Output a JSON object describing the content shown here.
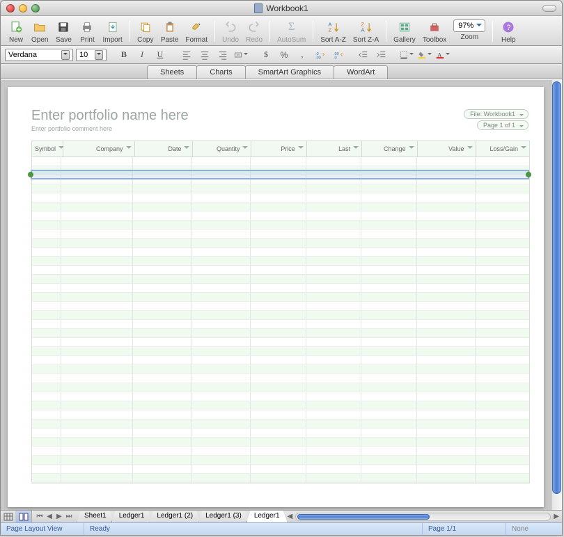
{
  "window": {
    "title": "Workbook1"
  },
  "toolbar": {
    "new": "New",
    "open": "Open",
    "save": "Save",
    "print": "Print",
    "import": "Import",
    "copy": "Copy",
    "paste": "Paste",
    "format": "Format",
    "undo": "Undo",
    "redo": "Redo",
    "autosum": "AutoSum",
    "sortaz": "Sort A-Z",
    "sortza": "Sort Z-A",
    "gallery": "Gallery",
    "toolbox": "Toolbox",
    "zoom": "Zoom",
    "zoom_value": "97%",
    "help": "Help"
  },
  "format_bar": {
    "font": "Verdana",
    "size": "10"
  },
  "tabs": {
    "sheets": "Sheets",
    "charts": "Charts",
    "smartart": "SmartArt Graphics",
    "wordart": "WordArt"
  },
  "portfolio": {
    "title": "Enter portfolio name here",
    "subtitle": "Enter portfolio comment here",
    "file_info": "File: Workbook1",
    "page_info": "Page 1 of 1",
    "columns": [
      "Symbol",
      "Company",
      "Date",
      "Quantity",
      "Price",
      "Last",
      "Change",
      "Value",
      "Loss/Gain"
    ]
  },
  "sheet_tabs": [
    "Sheet1",
    "Ledger1",
    "Ledger1 (2)",
    "Ledger1 (3)",
    "Ledger1"
  ],
  "active_sheet_index": 4,
  "status": {
    "view": "Page Layout View",
    "ready": "Ready",
    "page": "Page 1/1",
    "extras": "None"
  }
}
